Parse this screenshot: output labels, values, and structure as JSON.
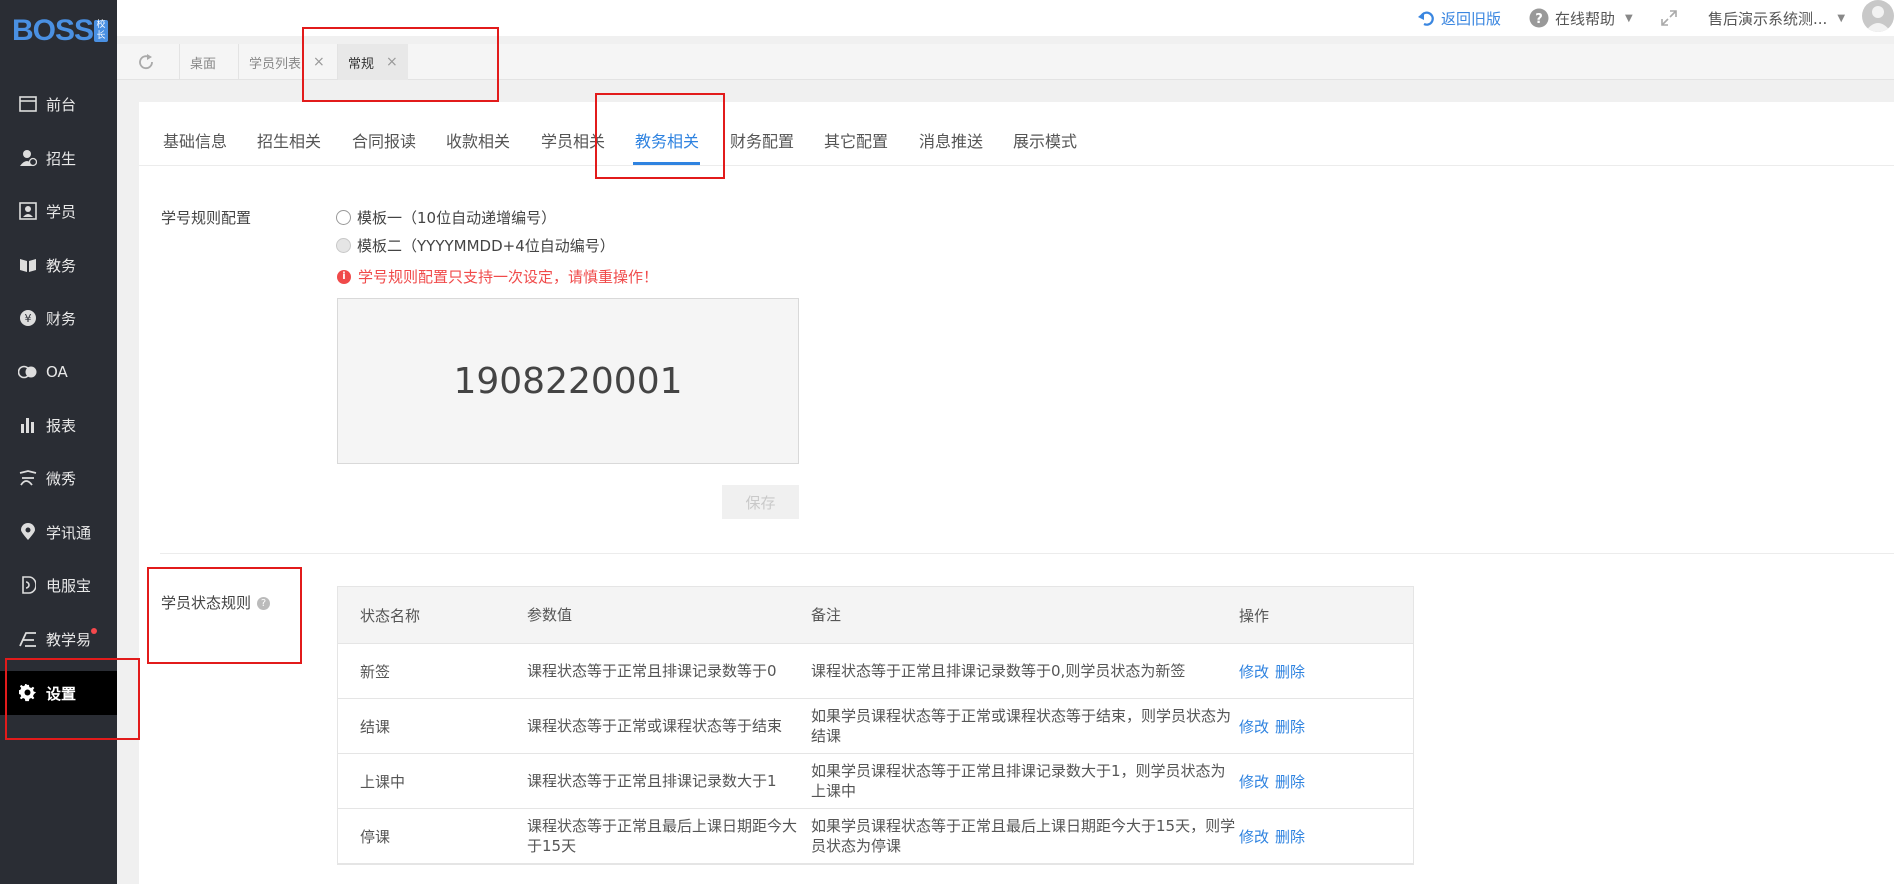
{
  "sidebar": {
    "logo": "BOSS",
    "logo_badge": "校长",
    "items": [
      {
        "label": "前台",
        "icon": "browser-icon"
      },
      {
        "label": "招生",
        "icon": "enroll-icon"
      },
      {
        "label": "学员",
        "icon": "student-icon"
      },
      {
        "label": "教务",
        "icon": "book-icon"
      },
      {
        "label": "财务",
        "icon": "yen-icon"
      },
      {
        "label": "OA",
        "icon": "toggle-icon"
      },
      {
        "label": "报表",
        "icon": "bar-chart-icon"
      },
      {
        "label": "微秀",
        "icon": "wave-icon"
      },
      {
        "label": "学讯通",
        "icon": "location-icon"
      },
      {
        "label": "电服宝",
        "icon": "phone-icon"
      },
      {
        "label": "教学易",
        "icon": "teaching-icon"
      },
      {
        "label": "设置",
        "icon": "gear-icon"
      }
    ]
  },
  "topbar": {
    "back_old": "返回旧版",
    "help": "在线帮助",
    "user": "售后演示系统测..."
  },
  "tabs": [
    {
      "label": "桌面"
    },
    {
      "label": "学员列表"
    },
    {
      "label": "常规"
    }
  ],
  "subtabs": [
    "基础信息",
    "招生相关",
    "合同报读",
    "收款相关",
    "学员相关",
    "教务相关",
    "财务配置",
    "其它配置",
    "消息推送",
    "展示模式"
  ],
  "id_rule": {
    "label": "学号规则配置",
    "option1": "模板一（10位自动递增编号）",
    "option2": "模板二（YYYYMMDD+4位自动编号）",
    "warning": "学号规则配置只支持一次设定，请慎重操作！",
    "preview": "1908220001",
    "save": "保存"
  },
  "status_rule": {
    "label": "学员状态规则",
    "headers": [
      "状态名称",
      "参数值",
      "备注",
      "操作"
    ],
    "rows": [
      {
        "name": "新签",
        "param": "课程状态等于正常且排课记录数等于0",
        "note": "课程状态等于正常且排课记录数等于0,则学员状态为新签"
      },
      {
        "name": "结课",
        "param": "课程状态等于正常或课程状态等于结束",
        "note": "如果学员课程状态等于正常或课程状态等于结束，则学员状态为结课"
      },
      {
        "name": "上课中",
        "param": "课程状态等于正常且排课记录数大于1",
        "note": "如果学员课程状态等于正常且排课记录数大于1，则学员状态为上课中"
      },
      {
        "name": "停课",
        "param": "课程状态等于正常且最后上课日期距今大于15天",
        "note": "如果学员课程状态等于正常且最后上课日期距今大于15天，则学员状态为停课"
      }
    ],
    "edit": "修改",
    "delete": "删除"
  }
}
